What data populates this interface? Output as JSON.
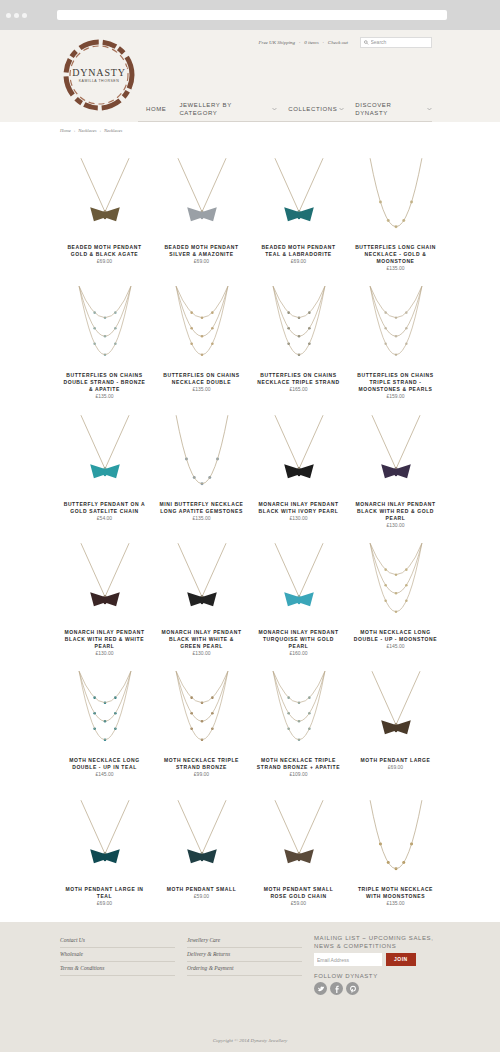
{
  "header": {
    "logo": {
      "title": "DYNASTY",
      "subtitle": "KAMILLA THORSEN"
    },
    "top_links": [
      "Free UK Shipping",
      "0 items",
      "Check out"
    ],
    "separator": "·",
    "search": {
      "placeholder": "Search"
    },
    "nav": [
      {
        "label": "HOME",
        "dropdown": false
      },
      {
        "label": "JEWELLERY BY CATEGORY",
        "dropdown": true
      },
      {
        "label": "COLLECTIONS",
        "dropdown": true
      },
      {
        "label": "DISCOVER DYNASTY",
        "dropdown": true
      }
    ]
  },
  "breadcrumb": {
    "items": [
      "Home",
      "Necklaces",
      "Necklaces"
    ],
    "separator": "›"
  },
  "products": [
    {
      "name": "BEADED MOTH PENDANT GOLD & BLACK AGATE",
      "price": "£69.00",
      "kind": "pendant",
      "color": "#6b5a3a"
    },
    {
      "name": "BEADED MOTH PENDANT SILVER & AMAZONITE",
      "price": "£69.00",
      "kind": "pendant",
      "color": "#9aa0a6"
    },
    {
      "name": "BEADED MOTH PENDANT TEAL & LABRADORITE",
      "price": "£69.00",
      "kind": "pendant",
      "color": "#1f6f73"
    },
    {
      "name": "BUTTERFLIES LONG CHAIN NECKLACE - GOLD & MOONSTONE",
      "price": "£135.00",
      "kind": "chain",
      "color": "#c9b98a"
    },
    {
      "name": "BUTTERFLIES ON CHAINS DOUBLE STRAND - BRONZE & APATITE",
      "price": "£135.00",
      "kind": "multi",
      "color": "#8fb0b0"
    },
    {
      "name": "BUTTERFLIES ON CHAINS NECKLACE DOUBLE",
      "price": "£135.00",
      "kind": "multi",
      "color": "#c2a878"
    },
    {
      "name": "BUTTERFLIES ON CHAINS NECKLACE TRIPLE STRAND",
      "price": "£165.00",
      "kind": "multi",
      "color": "#8a8a7a"
    },
    {
      "name": "BUTTERFLIES ON CHAINS TRIPLE STRAND - MOONSTONES & PEARLS",
      "price": "£159.00",
      "kind": "multi",
      "color": "#c9c3b3"
    },
    {
      "name": "BUTTERFLY PENDANT ON A GOLD SATELITE CHAIN",
      "price": "£54.00",
      "kind": "pendant",
      "color": "#2a9ca3"
    },
    {
      "name": "MINI BUTTERFLY NECKLACE LONG APATITE GEMSTONES",
      "price": "£135.00",
      "kind": "chain",
      "color": "#8fa0a8"
    },
    {
      "name": "MONARCH INLAY PENDANT BLACK WITH IVORY PEARL",
      "price": "£130.00",
      "kind": "pendant",
      "color": "#1c1c1c"
    },
    {
      "name": "MONARCH INLAY PENDANT BLACK WITH RED & GOLD PEARL",
      "price": "£130.00",
      "kind": "pendant",
      "color": "#3a2e4a"
    },
    {
      "name": "MONARCH INLAY PENDANT BLACK WITH RED & WHITE PEARL",
      "price": "£130.00",
      "kind": "pendant",
      "color": "#3a2525"
    },
    {
      "name": "MONARCH INLAY PENDANT BLACK WITH WHITE & GREEN PEARL",
      "price": "£130.00",
      "kind": "pendant",
      "color": "#222222"
    },
    {
      "name": "MONARCH INLAY PENDANT TURQUOISE WITH GOLD PEARL",
      "price": "£160.00",
      "kind": "pendant",
      "color": "#3aa6b9"
    },
    {
      "name": "MOTH NECKLACE LONG DOUBLE - UP - MOONSTONE",
      "price": "£145.00",
      "kind": "multi",
      "color": "#c9b98a"
    },
    {
      "name": "MOTH NECKLACE LONG DOUBLE - UP IN TEAL",
      "price": "£145.00",
      "kind": "multi",
      "color": "#2a7f86"
    },
    {
      "name": "MOTH NECKLACE TRIPLE STRAND BRONZE",
      "price": "£99.00",
      "kind": "multi",
      "color": "#a0845a"
    },
    {
      "name": "MOTH NECKLACE TRIPLE STRAND BRONZE + APATITE",
      "price": "£109.00",
      "kind": "multi",
      "color": "#8aa6a0"
    },
    {
      "name": "MOTH PENDANT LARGE",
      "price": "£69.00",
      "kind": "pendant",
      "color": "#4a3a2a"
    },
    {
      "name": "MOTH PENDANT LARGE IN TEAL",
      "price": "£69.00",
      "kind": "pendant",
      "color": "#0f4a52"
    },
    {
      "name": "MOTH PENDANT SMALL",
      "price": "£59.00",
      "kind": "pendant",
      "color": "#1f3f44"
    },
    {
      "name": "MOTH PENDANT SMALL ROSE GOLD CHAIN",
      "price": "£59.00",
      "kind": "pendant",
      "color": "#5a4a3a"
    },
    {
      "name": "TRIPLE MOTH NECKLACE WITH MOONSTONES",
      "price": "£135.00",
      "kind": "chain",
      "color": "#b89a5a"
    }
  ],
  "footer": {
    "links_1": [
      "Contact Us",
      "Wholesale",
      "Terms & Conditions"
    ],
    "links_2": [
      "Jewellery Care",
      "Delivery & Returns",
      "Ordering & Payment"
    ],
    "mailing_title": "MAILING LIST ~ UPCOMING SALES, NEWS & COMPETITIONS",
    "email": {
      "placeholder": "Email Address"
    },
    "join": "JOIN",
    "follow_title": "FOLLOW DYNASTY",
    "copyright": "Copyright © 2014 Dynasty Jewellery"
  }
}
